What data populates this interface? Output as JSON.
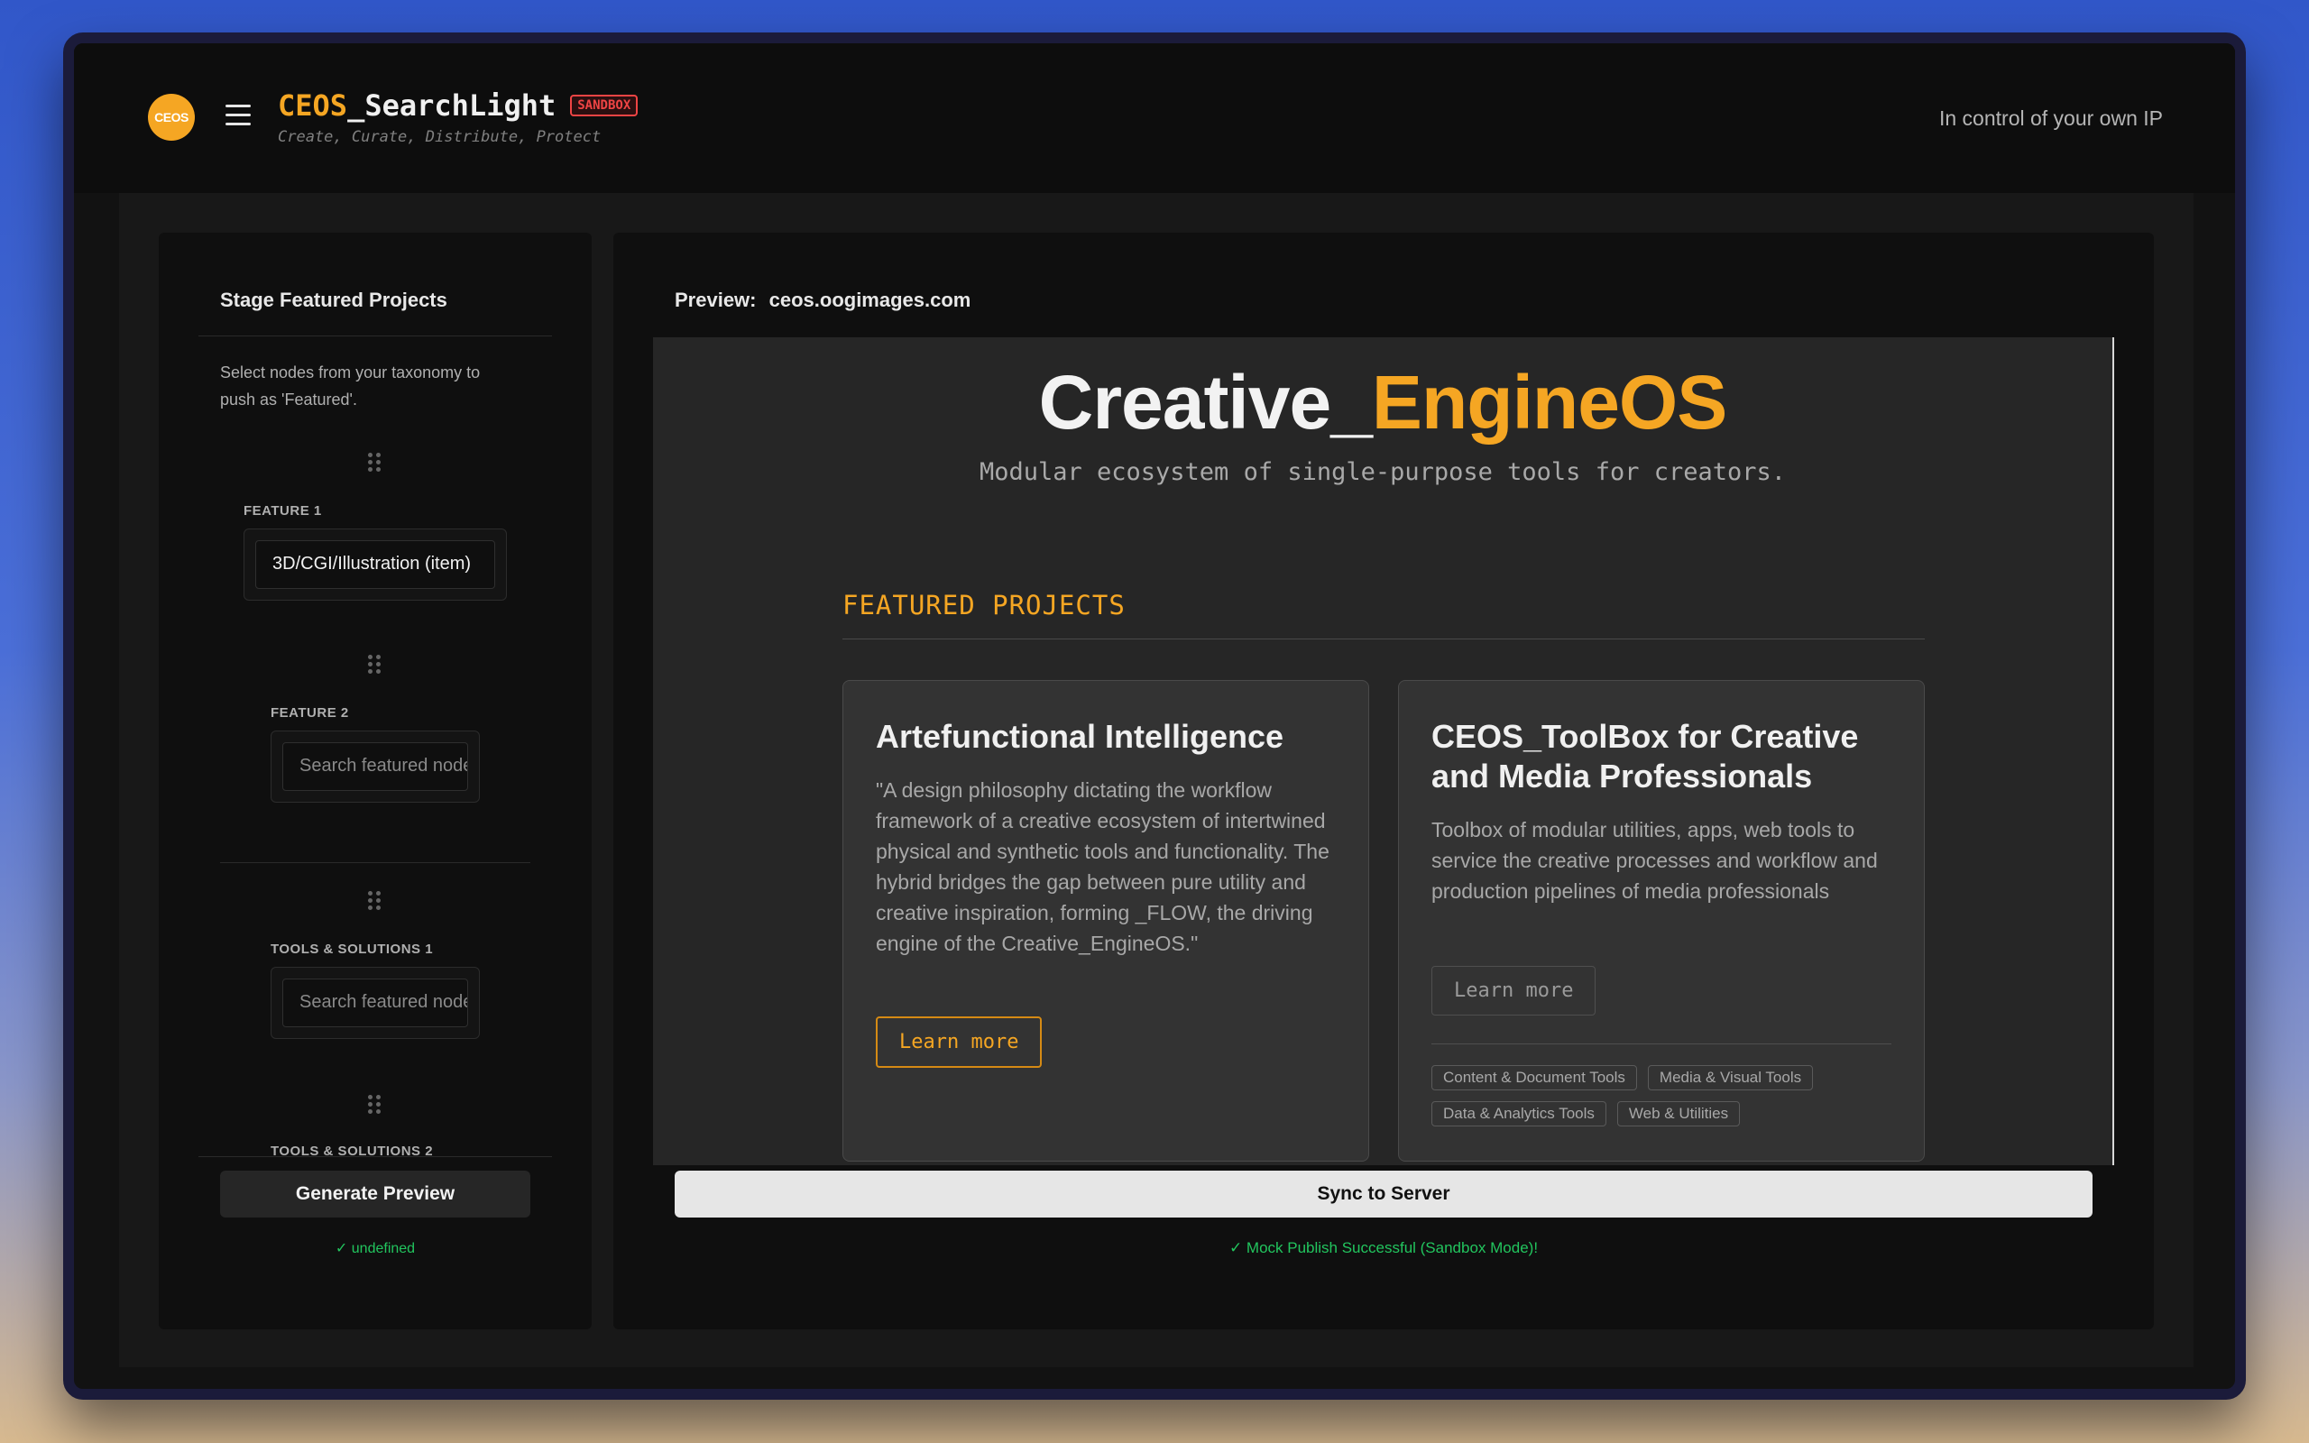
{
  "header": {
    "logo_text": "CEOS",
    "brand_accent": "CEOS",
    "brand_rest": "_SearchLight",
    "badge": "SANDBOX",
    "tagline": "Create, Curate, Distribute, Protect",
    "right_text": "In control of your own IP"
  },
  "left_panel": {
    "title": "Stage Featured Projects",
    "description": "Select nodes from your taxonomy to push as 'Featured'.",
    "slots": [
      {
        "label": "FEATURE 1",
        "value": "3D/CGI/Illustration (item)",
        "placeholder": ""
      },
      {
        "label": "FEATURE 2",
        "value": "",
        "placeholder": "Search featured node..."
      },
      {
        "label": "TOOLS & SOLUTIONS 1",
        "value": "",
        "placeholder": "Search featured node..."
      },
      {
        "label": "TOOLS & SOLUTIONS 2",
        "value": "",
        "placeholder": ""
      }
    ],
    "generate_label": "Generate Preview",
    "generate_status": "✓ undefined"
  },
  "right_panel": {
    "preview_label": "Preview:",
    "preview_url": "ceos.oogimages.com",
    "hero_title_main": "Creative_",
    "hero_title_accent": "EngineOS",
    "hero_subtitle": "Modular ecosystem of single-purpose tools for creators.",
    "featured_heading": "FEATURED PROJECTS",
    "cards": [
      {
        "title": "Artefunctional Intelligence",
        "description": "\"A design philosophy dictating the workflow framework of a creative ecosystem of intertwined physical and synthetic tools and functionality. The hybrid bridges the gap between pure utility and creative inspiration, forming _FLOW, the driving engine of the Creative_EngineOS.\"",
        "button": "Learn more"
      },
      {
        "title": "CEOS_ToolBox for Creative and Media Professionals",
        "description": "Toolbox of modular utilities, apps, web tools to service the creative processes and workflow and production pipelines of media professionals",
        "button": "Learn more",
        "tags": [
          "Content & Document Tools",
          "Media & Visual Tools",
          "Data & Analytics Tools",
          "Web & Utilities"
        ]
      }
    ],
    "sync_label": "Sync to Server",
    "sync_status": "✓ Mock Publish Successful (Sandbox Mode)!"
  },
  "colors": {
    "accent": "#f5a623",
    "badge": "#ef4444",
    "success": "#22c55e"
  }
}
